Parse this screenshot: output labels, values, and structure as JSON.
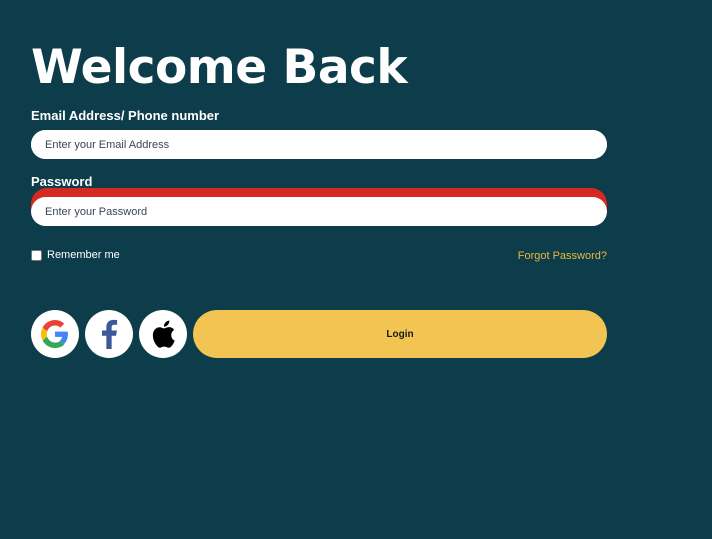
{
  "title": "Welcome Back",
  "email": {
    "label": "Email Address/ Phone number",
    "placeholder": "Enter your Email Address",
    "value": ""
  },
  "password": {
    "label": "Password",
    "placeholder": "Enter your Password",
    "value": ""
  },
  "remember_me": {
    "label": "Remember me",
    "checked": false
  },
  "forgot_password": "Forgot Password?",
  "social": [
    {
      "icon": "google-icon"
    },
    {
      "icon": "facebook-icon"
    },
    {
      "icon": "apple-icon"
    }
  ],
  "login_label": "Login",
  "colors": {
    "background": "#0d3c4b",
    "accent": "#f2c552",
    "link": "#e8b93c",
    "error_highlight": "#d42a22"
  }
}
